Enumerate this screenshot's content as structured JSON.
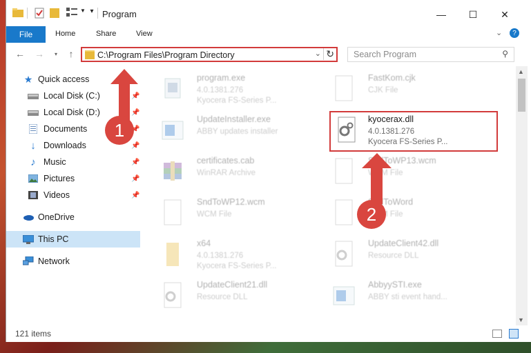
{
  "window": {
    "title": "Program",
    "controls": {
      "minimize": "—",
      "maximize": "☐",
      "close": "✕"
    }
  },
  "ribbon": {
    "file_label": "File",
    "tabs": [
      "Home",
      "Share",
      "View"
    ]
  },
  "address": {
    "path": "C:\\Program Files\\Program Directory"
  },
  "search": {
    "placeholder": "Search Program"
  },
  "sidebar": {
    "items": [
      {
        "label": "Quick access",
        "icon": "star-icon"
      },
      {
        "label": "Local Disk (C:)",
        "icon": "drive-icon"
      },
      {
        "label": "Local Disk (D:)",
        "icon": "drive-icon"
      },
      {
        "label": "Documents",
        "icon": "documents-icon"
      },
      {
        "label": "Downloads",
        "icon": "download-icon"
      },
      {
        "label": "Music",
        "icon": "music-icon"
      },
      {
        "label": "Pictures",
        "icon": "pictures-icon"
      },
      {
        "label": "Videos",
        "icon": "videos-icon"
      },
      {
        "label": "OneDrive",
        "icon": "cloud-icon"
      },
      {
        "label": "This PC",
        "icon": "computer-icon"
      },
      {
        "label": "Network",
        "icon": "network-icon"
      }
    ]
  },
  "files": [
    {
      "name": "program.exe",
      "line2": "4.0.1381.276",
      "line3": "Kyocera FS-Series P...",
      "icon": "exe-icon"
    },
    {
      "name": "FastKom.cjk",
      "line2": "CJK File",
      "line3": "",
      "icon": "file-icon"
    },
    {
      "name": "UpdateInstaller.exe",
      "line2": "ABBY updates installer",
      "line3": "",
      "icon": "installer-icon"
    },
    {
      "name": "kyocerax.dll",
      "line2": "4.0.1381.276",
      "line3": "Kyocera FS-Series P...",
      "icon": "dll-gear-icon"
    },
    {
      "name": "certificates.cab",
      "line2": "WinRAR Archive",
      "line3": "",
      "icon": "archive-icon"
    },
    {
      "name": "SndToWP13.wcm",
      "line2": "WCM File",
      "line3": "",
      "icon": "file-icon"
    },
    {
      "name": "SndToWP12.wcm",
      "line2": "WCM File",
      "line3": "",
      "icon": "file-icon"
    },
    {
      "name": "SndToWord",
      "line2": "WCM File",
      "line3": "",
      "icon": "file-icon"
    },
    {
      "name": "x64",
      "line2": "4.0.1381.276",
      "line3": "Kyocera FS-Series P...",
      "icon": "folder-icon"
    },
    {
      "name": "UpdateClient42.dll",
      "line2": "Resource DLL",
      "line3": "",
      "icon": "dll-gear-icon"
    },
    {
      "name": "UpdateClient21.dll",
      "line2": "Resource DLL",
      "line3": "",
      "icon": "dll-gear-icon"
    },
    {
      "name": "AbbyySTI.exe",
      "line2": "ABBY sti event hand...",
      "line3": "",
      "icon": "exe-icon"
    }
  ],
  "status": {
    "items_count": "121 items"
  },
  "callouts": [
    "1",
    "2"
  ],
  "colors": {
    "highlight": "#d23a3a",
    "accent": "#1979ca",
    "callout": "#d9463f"
  }
}
